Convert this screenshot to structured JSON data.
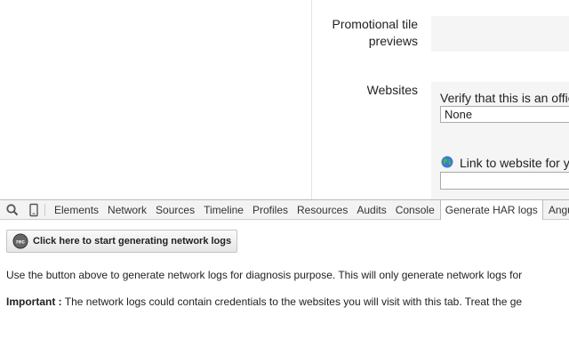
{
  "page": {
    "promo_label": "Promotional tile previews",
    "websites_label": "Websites",
    "verify_text": "Verify that this is an offic",
    "select_value": "None",
    "link_text": "Link to website for yo"
  },
  "devtools": {
    "tabs": [
      {
        "label": "Elements",
        "active": false
      },
      {
        "label": "Network",
        "active": false
      },
      {
        "label": "Sources",
        "active": false
      },
      {
        "label": "Timeline",
        "active": false
      },
      {
        "label": "Profiles",
        "active": false
      },
      {
        "label": "Resources",
        "active": false
      },
      {
        "label": "Audits",
        "active": false
      },
      {
        "label": "Console",
        "active": false
      },
      {
        "label": "Generate HAR logs",
        "active": true
      },
      {
        "label": "Angul",
        "active": false
      }
    ],
    "panel": {
      "button_icon_text": "rec",
      "button_label": "Click here to start generating network logs",
      "info_text": "Use the button above to generate network logs for diagnosis purpose. This will only generate network logs for",
      "important_label": "Important :",
      "important_text": " The network logs could contain credentials to the websites you will visit with this tab. Treat the ge"
    }
  },
  "colors": {
    "toolbar_bg": "#f3f3f3",
    "box_bg": "#f5f5f5"
  }
}
